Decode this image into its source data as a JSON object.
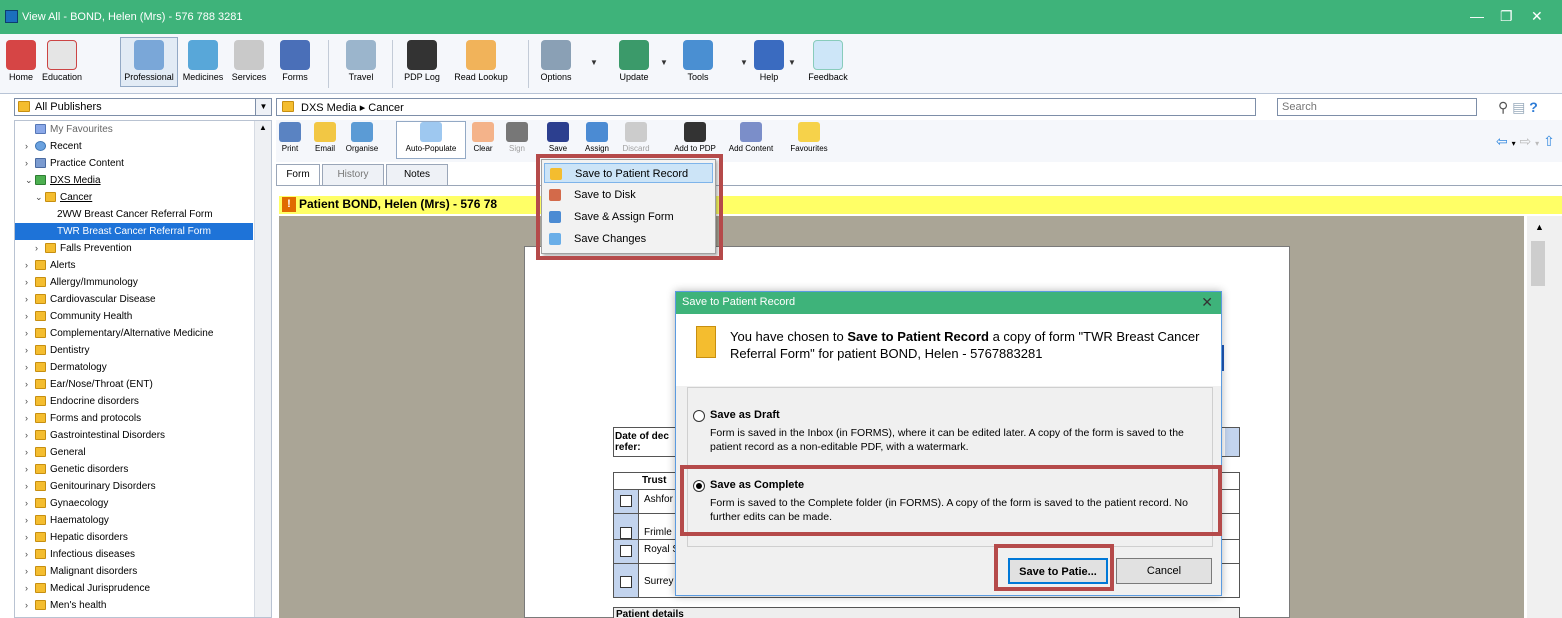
{
  "window": {
    "title": "View All  -  BOND, Helen (Mrs) - 576 788 3281"
  },
  "ribbon": [
    {
      "label": "Home"
    },
    {
      "label": "Education"
    },
    {
      "label": "Professional"
    },
    {
      "label": "Medicines"
    },
    {
      "label": "Services"
    },
    {
      "label": "Forms"
    },
    {
      "label": "Travel"
    },
    {
      "label": "PDP Log"
    },
    {
      "label": "Read Lookup"
    },
    {
      "label": "Options"
    },
    {
      "label": "Update"
    },
    {
      "label": "Tools"
    },
    {
      "label": "Help"
    },
    {
      "label": "Feedback"
    }
  ],
  "publisher": {
    "value": "All Publishers"
  },
  "breadcrumb": {
    "root": "DXS Media",
    "sep": "▸",
    "leaf": "Cancer"
  },
  "search": {
    "placeholder": "Search"
  },
  "tree": [
    {
      "label": "My Favourites"
    },
    {
      "label": "Recent"
    },
    {
      "label": "Practice Content"
    },
    {
      "label": "DXS Media"
    },
    {
      "label": "Cancer"
    },
    {
      "label": "2WW Breast Cancer Referral Form"
    },
    {
      "label": "TWR Breast Cancer Referral Form"
    },
    {
      "label": "Falls Prevention"
    },
    {
      "label": "Alerts"
    },
    {
      "label": "Allergy/Immunology"
    },
    {
      "label": "Cardiovascular Disease"
    },
    {
      "label": "Community Health"
    },
    {
      "label": "Complementary/Alternative Medicine"
    },
    {
      "label": "Dentistry"
    },
    {
      "label": "Dermatology"
    },
    {
      "label": "Ear/Nose/Throat (ENT)"
    },
    {
      "label": "Endocrine disorders"
    },
    {
      "label": "Forms and protocols"
    },
    {
      "label": "Gastrointestinal Disorders"
    },
    {
      "label": "General"
    },
    {
      "label": "Genetic disorders"
    },
    {
      "label": "Genitourinary Disorders"
    },
    {
      "label": "Gynaecology"
    },
    {
      "label": "Haematology"
    },
    {
      "label": "Hepatic disorders"
    },
    {
      "label": "Infectious diseases"
    },
    {
      "label": "Malignant disorders"
    },
    {
      "label": "Medical Jurisprudence"
    },
    {
      "label": "Men's health"
    }
  ],
  "toolbar": [
    {
      "label": "Print"
    },
    {
      "label": "Email"
    },
    {
      "label": "Organise"
    },
    {
      "label": "Auto-Populate"
    },
    {
      "label": "Clear"
    },
    {
      "label": "Sign"
    },
    {
      "label": "Save"
    },
    {
      "label": "Assign"
    },
    {
      "label": "Discard"
    },
    {
      "label": "Add to PDP"
    },
    {
      "label": "Add Content"
    },
    {
      "label": "Favourites"
    }
  ],
  "tabs": [
    {
      "label": "Form"
    },
    {
      "label": "History"
    },
    {
      "label": "Notes"
    }
  ],
  "patient_bar": {
    "text": "Patient BOND, Helen (Mrs) - 576 78",
    "warn": "!"
  },
  "save_menu": [
    {
      "label": "Save to Patient Record"
    },
    {
      "label": "Save to Disk"
    },
    {
      "label": "Save & Assign Form"
    },
    {
      "label": "Save Changes"
    }
  ],
  "form": {
    "date_label": "Date of dec\nrefer:",
    "trust_header": "Trust",
    "trusts": [
      "Ashfor",
      "Frimle",
      "Royal S",
      "Surrey"
    ],
    "patient_details": "Patient details"
  },
  "dialog": {
    "title": "Save to Patient Record",
    "msg_pre": "You have chosen to ",
    "msg_bold": "Save to Patient Record",
    "msg_post": " a copy of form \"TWR Breast Cancer Referral Form\" for patient BOND, Helen - 5767883281",
    "draft_title": "Save as Draft",
    "draft_desc": "Form is saved in the Inbox (in FORMS), where it can be edited later. A copy of the form is saved to the patient record as a non-editable PDF, with a watermark.",
    "complete_title": "Save as Complete",
    "complete_desc": "Form is saved to the Complete folder (in FORMS). A copy of the form is saved to the patient record. No further edits can be made.",
    "ok_label": "Save to Patie...",
    "cancel_label": "Cancel"
  },
  "colors": {
    "title_green": "#3eb37a",
    "highlight_red": "#b54a4a",
    "selection_blue": "#1e73d8",
    "patient_yellow": "#ffff66"
  }
}
